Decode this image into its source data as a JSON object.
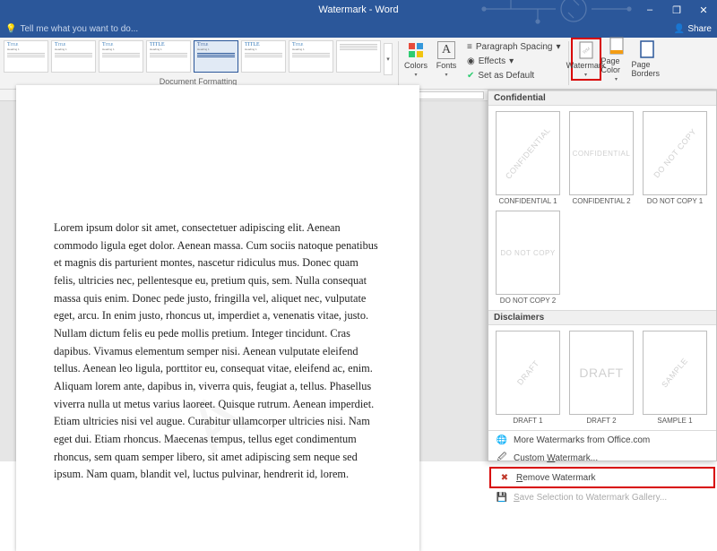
{
  "titlebar": {
    "title": "Watermark - Word"
  },
  "window_controls": {
    "min": "–",
    "restore": "❐",
    "close": "✕"
  },
  "tellme": {
    "placeholder": "Tell me what you want to do...",
    "share": "Share"
  },
  "ribbon": {
    "styles": [
      "Title",
      "Title",
      "Title",
      "TITLE",
      "Title",
      "TITLE",
      "Title"
    ],
    "styles_sub": "Heading 1",
    "group_formatting": "Document Formatting",
    "colors": "Colors",
    "fonts": "Fonts",
    "paragraph_spacing": "Paragraph Spacing",
    "effects": "Effects",
    "set_default": "Set as Default",
    "watermark": "Watermark",
    "page_color": "Page Color",
    "page_borders": "Page Borders"
  },
  "document": {
    "body": "Lorem ipsum dolor sit amet, consectetuer adipiscing elit. Aenean commodo ligula eget dolor. Aenean massa. Cum sociis natoque penatibus et magnis dis parturient montes, nascetur ridiculus mus. Donec quam felis, ultricies nec, pellentesque eu, pretium quis, sem. Nulla consequat massa quis enim. Donec pede justo, fringilla vel, aliquet nec, vulputate eget, arcu. In enim justo, rhoncus ut, imperdiet a, venenatis vitae, justo. Nullam dictum felis eu pede mollis pretium. Integer tincidunt. Cras dapibus. Vivamus elementum semper nisi. Aenean vulputate eleifend tellus. Aenean leo ligula, porttitor eu, consequat vitae, eleifend ac, enim. Aliquam lorem ante, dapibus in, viverra quis, feugiat a, tellus. Phasellus viverra nulla ut metus varius laoreet. Quisque rutrum. Aenean imperdiet. Etiam ultricies nisi vel augue. Curabitur ullamcorper ultricies nisi. Nam eget dui. Etiam rhoncus. Maecenas tempus, tellus eget condimentum rhoncus, sem quam semper libero, sit amet adipiscing sem neque sed ipsum. Nam quam, blandit vel, luctus pulvinar, hendrerit id, lorem."
  },
  "wm_panel": {
    "section_confidential": "Confidential",
    "section_disclaimers": "Disclaimers",
    "confidential": [
      {
        "text": "CONFIDENTIAL",
        "style": "diag",
        "caption": "CONFIDENTIAL 1"
      },
      {
        "text": "CONFIDENTIAL",
        "style": "horiz",
        "caption": "CONFIDENTIAL 2"
      },
      {
        "text": "DO NOT COPY",
        "style": "diag",
        "caption": "DO NOT COPY 1"
      },
      {
        "text": "DO NOT COPY",
        "style": "horiz",
        "caption": "DO NOT COPY 2"
      }
    ],
    "disclaimers": [
      {
        "text": "DRAFT",
        "style": "diag",
        "caption": "DRAFT 1"
      },
      {
        "text": "DRAFT",
        "style": "horiz",
        "caption": "DRAFT 2"
      },
      {
        "text": "SAMPLE",
        "style": "diag",
        "caption": "SAMPLE 1"
      }
    ],
    "menu": {
      "more": "More Watermarks from Office.com",
      "custom": "Custom Watermark...",
      "remove": "Remove Watermark",
      "save_sel": "Save Selection to Watermark Gallery..."
    }
  }
}
